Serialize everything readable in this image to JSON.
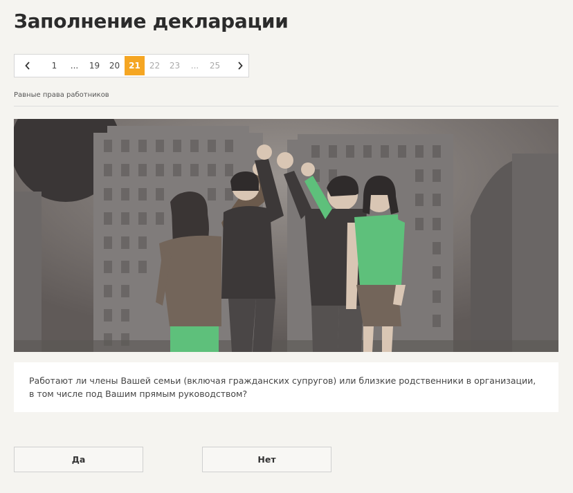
{
  "page": {
    "title": "Заполнение декларации"
  },
  "pagination": {
    "prev_icon": "chevron-left-icon",
    "next_icon": "chevron-right-icon",
    "items": [
      "1",
      "...",
      "19",
      "20",
      "21",
      "22",
      "23",
      "...",
      "25"
    ],
    "current": "21"
  },
  "section": {
    "label": "Равные права работников"
  },
  "illustration": {
    "subject": "team-high-five-illustration"
  },
  "question": {
    "text": "Работают ли члены Вашей семьи (включая гражданских супругов) или близкие родственники в организации, в том числе под Вашим прямым руководством?"
  },
  "answers": {
    "yes_label": "Да",
    "no_label": "Нет"
  },
  "colors": {
    "accent": "#f5a623",
    "background": "#f5f4f0"
  }
}
